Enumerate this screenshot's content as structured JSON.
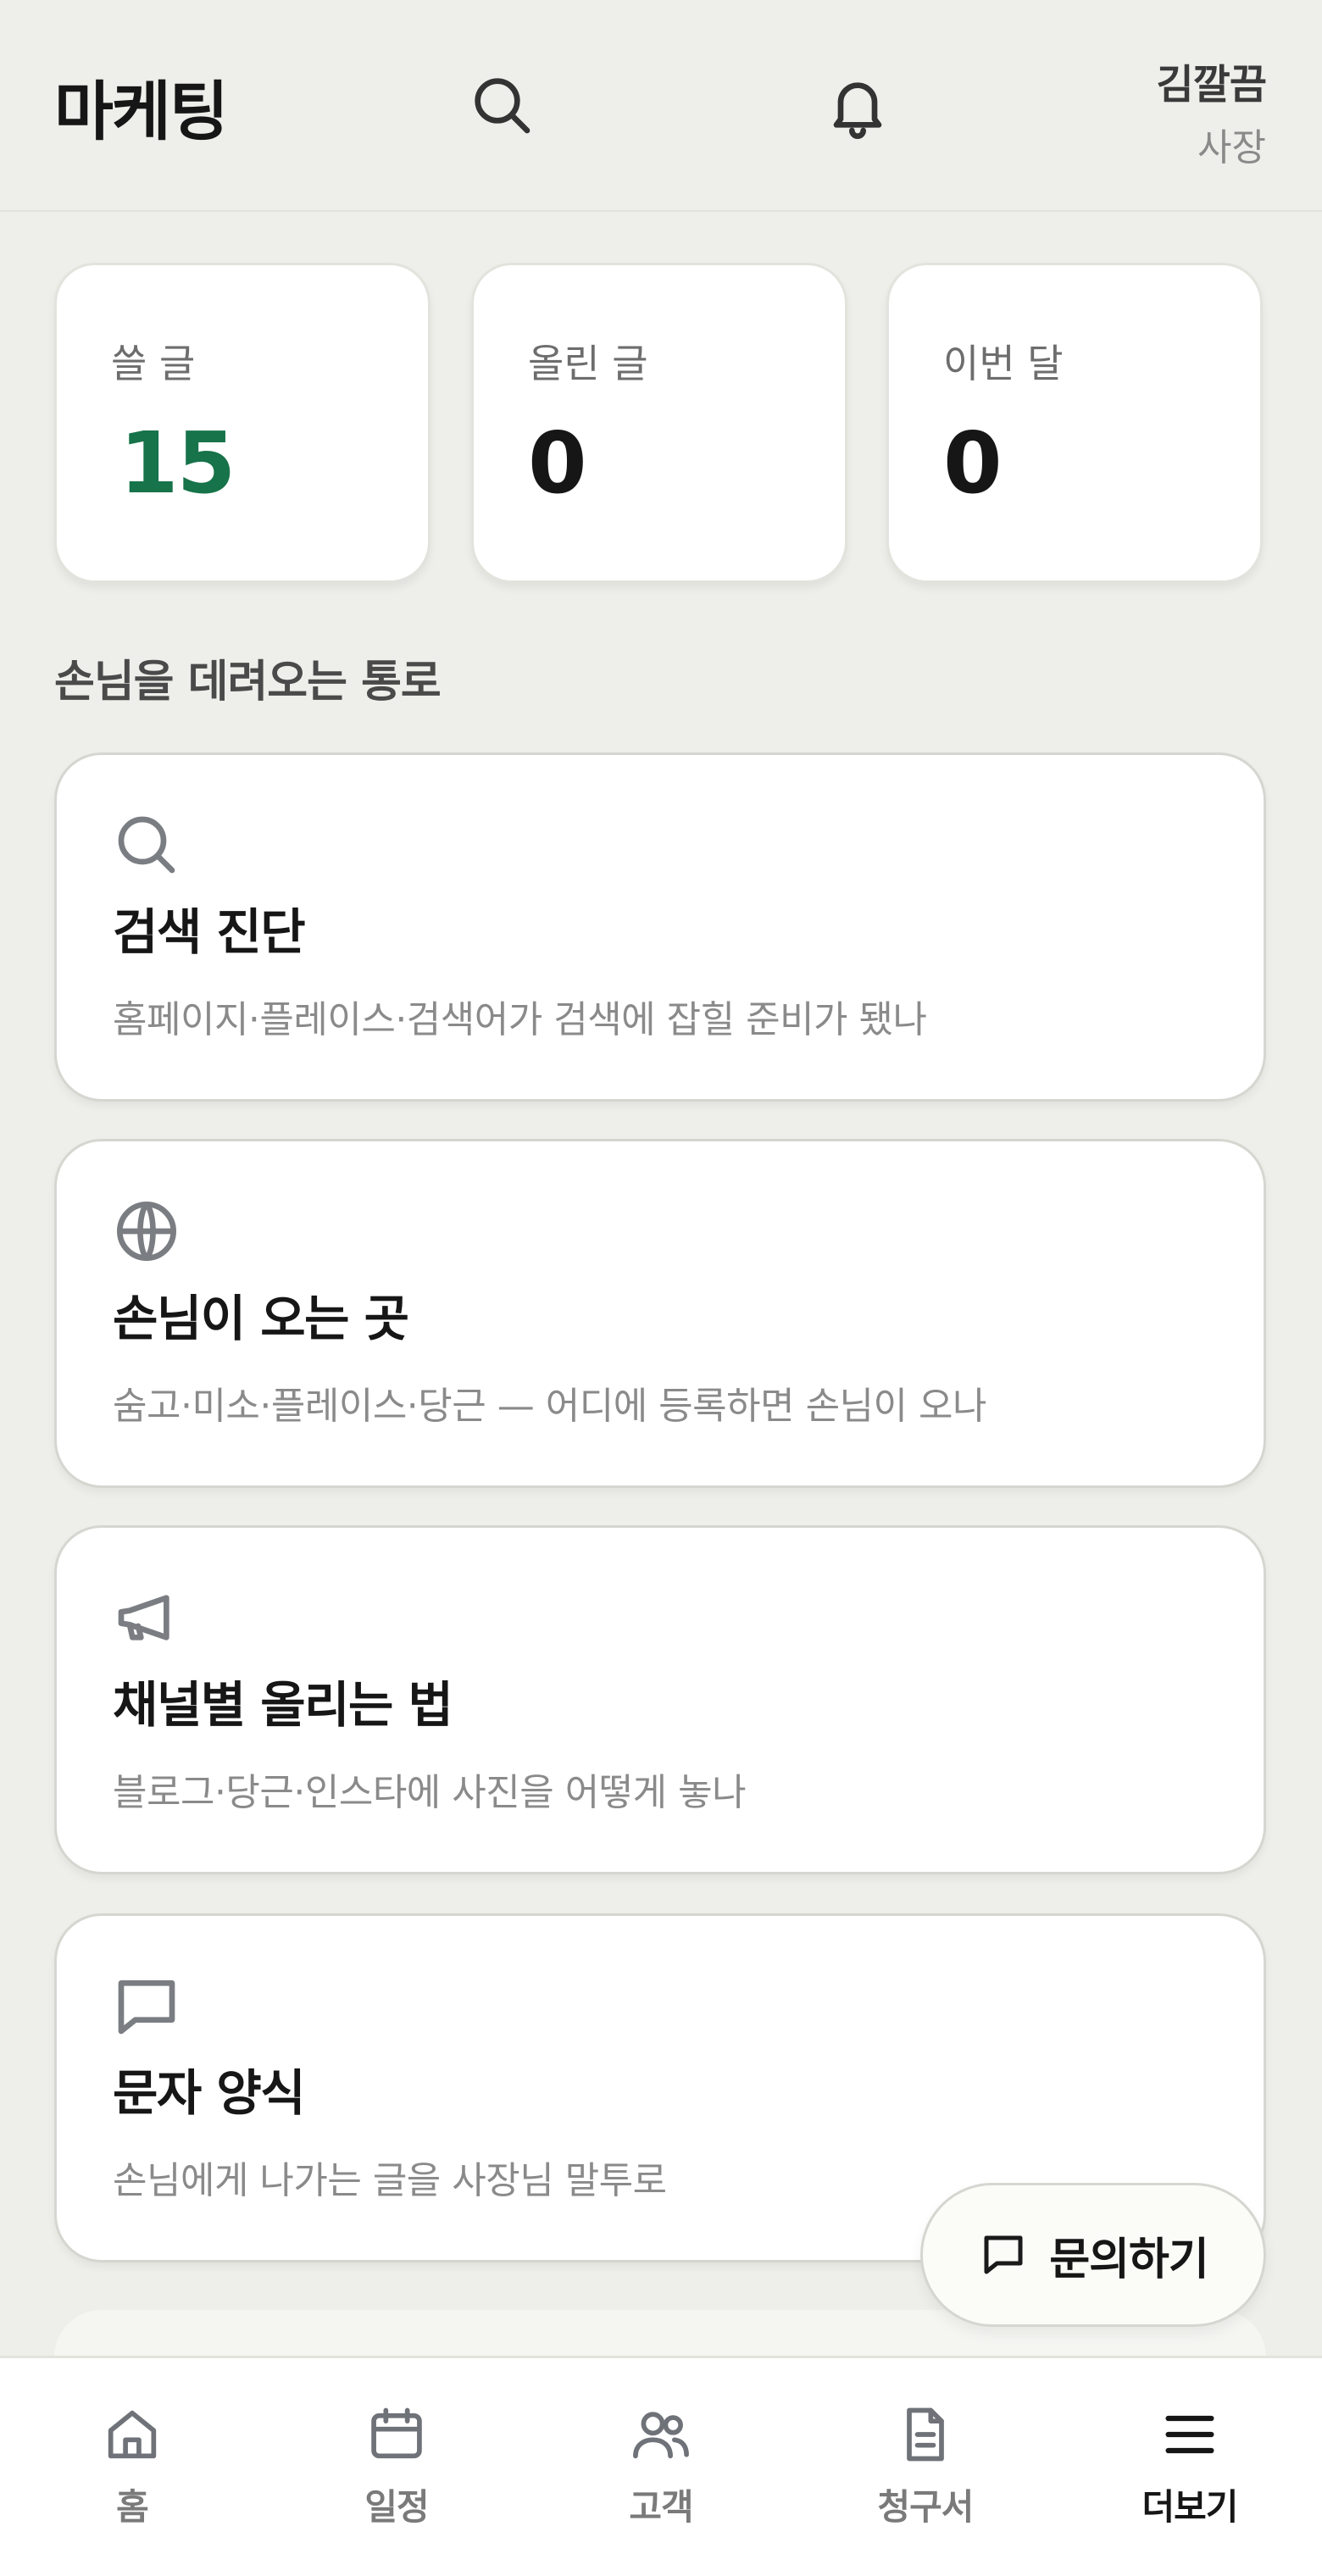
{
  "header": {
    "title": "마케팅",
    "user_name": "김깔끔",
    "user_role": "사장"
  },
  "stats": [
    {
      "label": "쓸 글",
      "value": "15"
    },
    {
      "label": "올린 글",
      "value": "0"
    },
    {
      "label": "이번 달",
      "value": "0"
    }
  ],
  "colors": {
    "accent": "#17734a",
    "background": "#eeeeea"
  },
  "section": {
    "title": "손님을 데려오는 통로"
  },
  "features": [
    {
      "icon": "search-icon",
      "title": "검색 진단",
      "desc": "홈페이지·플레이스·검색어가 검색에 잡힐 준비가 됐나"
    },
    {
      "icon": "globe-icon",
      "title": "손님이 오는 곳",
      "desc": "숨고·미소·플레이스·당근 — 어디에 등록하면 손님이 오나"
    },
    {
      "icon": "megaphone-icon",
      "title": "채널별 올리는 법",
      "desc": "블로그·당근·인스타에 사진을 어떻게 놓나"
    },
    {
      "icon": "message-icon",
      "title": "문자 양식",
      "desc": "손님에게 나가는 글을 사장님 말투로"
    }
  ],
  "fab": {
    "label": "문의하기",
    "icon": "chat-icon"
  },
  "nav": [
    {
      "label": "홈",
      "icon": "home-icon"
    },
    {
      "label": "일정",
      "icon": "calendar-icon"
    },
    {
      "label": "고객",
      "icon": "users-icon"
    },
    {
      "label": "청구서",
      "icon": "document-icon"
    },
    {
      "label": "더보기",
      "icon": "menu-icon",
      "active": true
    }
  ]
}
